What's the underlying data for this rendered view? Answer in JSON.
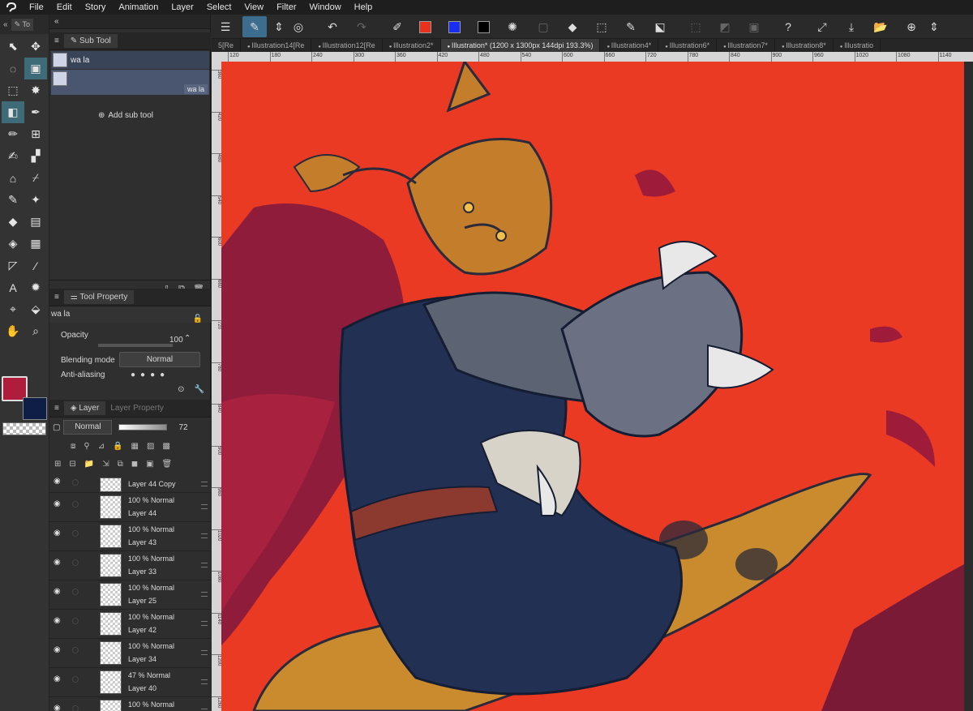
{
  "menubar": {
    "items": [
      "File",
      "Edit",
      "Story",
      "Animation",
      "Layer",
      "Select",
      "View",
      "Filter",
      "Window",
      "Help"
    ]
  },
  "toolcol": {
    "tab_label": "To",
    "tools": [
      {
        "name": "operation",
        "icon": "operation-icon"
      },
      {
        "name": "move",
        "icon": "move-icon"
      },
      {
        "name": "lasso",
        "icon": "lasso-icon"
      },
      {
        "name": "subtool-image",
        "icon": "brush-preview-icon",
        "active": true
      },
      {
        "name": "marquee",
        "icon": "marquee-icon"
      },
      {
        "name": "magic-wand",
        "icon": "magic-wand-icon"
      },
      {
        "name": "fill-pen",
        "icon": "fill-pen-icon",
        "active": true
      },
      {
        "name": "pen",
        "icon": "pen-icon"
      },
      {
        "name": "pencil",
        "icon": "pencil-icon"
      },
      {
        "name": "grid",
        "icon": "grid-icon"
      },
      {
        "name": "brush",
        "icon": "brush-icon"
      },
      {
        "name": "airbrush",
        "icon": "airbrush-icon"
      },
      {
        "name": "3d",
        "icon": "house-icon"
      },
      {
        "name": "eyedropper",
        "icon": "eyedropper-icon"
      },
      {
        "name": "decoration",
        "icon": "decoration-pen-icon"
      },
      {
        "name": "blend",
        "icon": "blend-icon"
      },
      {
        "name": "eraser",
        "icon": "eraser-icon"
      },
      {
        "name": "frame",
        "icon": "frame-icon"
      },
      {
        "name": "fill",
        "icon": "bucket-icon"
      },
      {
        "name": "gradient",
        "icon": "gradient-icon"
      },
      {
        "name": "figure",
        "icon": "figure-icon"
      },
      {
        "name": "line",
        "icon": "line-icon"
      },
      {
        "name": "text",
        "icon": "text-icon"
      },
      {
        "name": "balloon",
        "icon": "balloon-icon"
      },
      {
        "name": "correct-line",
        "icon": "correct-line-icon"
      },
      {
        "name": "object",
        "icon": "object-icon"
      },
      {
        "name": "hand",
        "icon": "hand-icon"
      },
      {
        "name": "zoom",
        "icon": "zoom-icon"
      }
    ],
    "main_color": "#b01c3c",
    "sub_color": "#0e1e46"
  },
  "subtool": {
    "title": "Sub Tool",
    "items": [
      {
        "label": "wa la"
      },
      {
        "label": "wa la"
      }
    ],
    "add_label": "Add sub tool"
  },
  "toolprop": {
    "title": "Tool Property",
    "brush_name": "wa la",
    "opacity_label": "Opacity",
    "opacity_value": "100",
    "blend_label": "Blending mode",
    "blend_value": "Normal",
    "antialias_label": "Anti-aliasing"
  },
  "layerpanel": {
    "tab_layer": "Layer",
    "tab_prop": "Layer Property",
    "blend_mode": "Normal",
    "opacity": "72",
    "layers": [
      {
        "meta": "",
        "name": "Layer 44 Copy"
      },
      {
        "meta": "100 %  Normal",
        "name": "Layer 44"
      },
      {
        "meta": "100 %  Normal",
        "name": "Layer 43"
      },
      {
        "meta": "100 %  Normal",
        "name": "Layer 33"
      },
      {
        "meta": "100 %  Normal",
        "name": "Layer 25"
      },
      {
        "meta": "100 %  Normal",
        "name": "Layer 42"
      },
      {
        "meta": "100 %  Normal",
        "name": "Layer 34"
      },
      {
        "meta": "47 %  Normal",
        "name": "Layer 40"
      },
      {
        "meta": "100 %  Normal",
        "name": ""
      }
    ]
  },
  "cmdbar": {
    "colors": {
      "red": "#e8301e",
      "blue": "#1a2ef2",
      "black": "#000000"
    }
  },
  "tabs": [
    {
      "label": "5[Re",
      "active": false
    },
    {
      "label": "Illustration14[Re",
      "active": false
    },
    {
      "label": "Illustration12[Re",
      "active": false
    },
    {
      "label": "Illustration2*",
      "active": false
    },
    {
      "label": "Illustration* (1200 x 1300px 144dpi 193.3%)",
      "active": true
    },
    {
      "label": "Illustration4*",
      "active": false
    },
    {
      "label": "Illustration6*",
      "active": false
    },
    {
      "label": "Illustration7*",
      "active": false
    },
    {
      "label": "Illustration8*",
      "active": false
    },
    {
      "label": "Illustratio",
      "active": false
    }
  ],
  "ruler": {
    "top": [
      "120",
      "180",
      "240",
      "300",
      "360",
      "420",
      "480",
      "540",
      "600",
      "660",
      "720",
      "780",
      "840",
      "900",
      "960",
      "1020",
      "1080",
      "1140"
    ],
    "left": [
      "360",
      "420",
      "480",
      "540",
      "600",
      "660",
      "720",
      "780",
      "840",
      "900",
      "960",
      "1020",
      "1080",
      "1140",
      "1200",
      "1260"
    ]
  },
  "canvas": {
    "background": "#ea3a24"
  }
}
